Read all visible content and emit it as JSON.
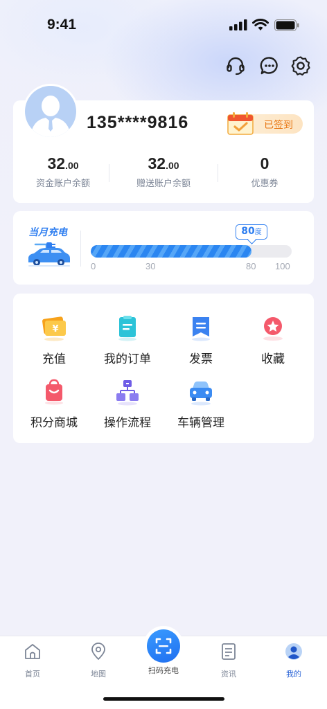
{
  "status": {
    "time": "9:41"
  },
  "header_icons": [
    "headset-icon",
    "chat-icon",
    "settings-icon"
  ],
  "profile": {
    "phone": "135****9816",
    "signed_label": "已签到",
    "stats": [
      {
        "int": "32",
        "dec": ".00",
        "label": "资金账户余额"
      },
      {
        "int": "32",
        "dec": ".00",
        "label": "赠送账户余额"
      },
      {
        "int": "0",
        "dec": "",
        "label": "优惠券"
      }
    ]
  },
  "monthly_charge": {
    "title": "当月充电",
    "value": "80",
    "unit": "度",
    "max": 100,
    "ticks": [
      "0",
      "30",
      "80",
      "100"
    ]
  },
  "menu": [
    {
      "label": "充值",
      "icon": "recharge-icon"
    },
    {
      "label": "我的订单",
      "icon": "orders-icon"
    },
    {
      "label": "发票",
      "icon": "invoice-icon"
    },
    {
      "label": "收藏",
      "icon": "favorites-icon"
    },
    {
      "label": "积分商城",
      "icon": "points-mall-icon"
    },
    {
      "label": "操作流程",
      "icon": "process-icon"
    },
    {
      "label": "车辆管理",
      "icon": "vehicle-icon"
    }
  ],
  "tabbar": {
    "tabs": [
      {
        "label": "首页",
        "icon": "home-icon"
      },
      {
        "label": "地图",
        "icon": "map-pin-icon"
      },
      {
        "label": "扫码充电",
        "icon": "scan-icon"
      },
      {
        "label": "资讯",
        "icon": "news-icon"
      },
      {
        "label": "我的",
        "icon": "profile-icon"
      }
    ],
    "active": "我的"
  },
  "colors": {
    "accent": "#2e7ef0",
    "signed": "#e87613",
    "background": "#f1f1fa"
  }
}
